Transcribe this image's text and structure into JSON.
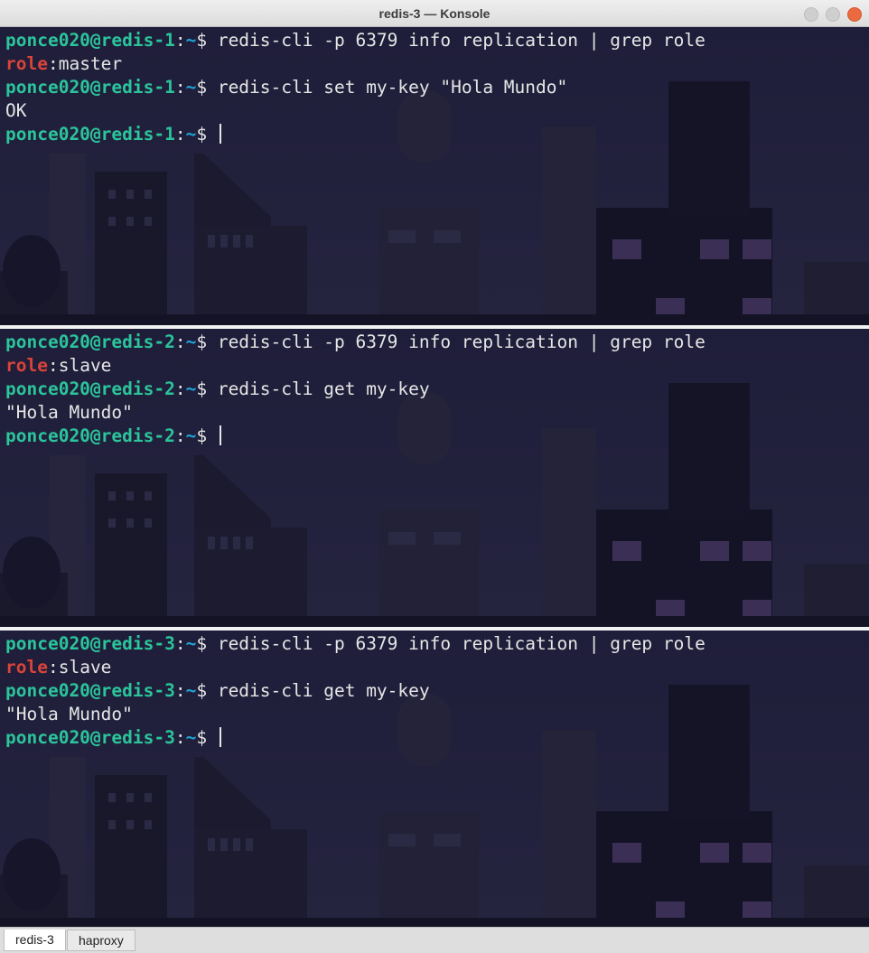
{
  "window": {
    "title": "redis-3 — Konsole"
  },
  "panes": [
    {
      "prompt_user": "ponce020@redis-1",
      "cwd": "~",
      "lines": [
        {
          "kind": "cmd",
          "command": "redis-cli -p 6379 info replication | grep role"
        },
        {
          "kind": "role",
          "key": "role",
          "value": "master"
        },
        {
          "kind": "cmd",
          "command": "redis-cli set my-key \"Hola Mundo\""
        },
        {
          "kind": "out",
          "text": "OK"
        },
        {
          "kind": "prompt"
        }
      ]
    },
    {
      "prompt_user": "ponce020@redis-2",
      "cwd": "~",
      "lines": [
        {
          "kind": "cmd",
          "command": "redis-cli -p 6379 info replication | grep role"
        },
        {
          "kind": "role",
          "key": "role",
          "value": "slave"
        },
        {
          "kind": "cmd",
          "command": "redis-cli get my-key"
        },
        {
          "kind": "out",
          "text": "\"Hola Mundo\""
        },
        {
          "kind": "prompt"
        }
      ]
    },
    {
      "prompt_user": "ponce020@redis-3",
      "cwd": "~",
      "lines": [
        {
          "kind": "cmd",
          "command": "redis-cli -p 6379 info replication | grep role"
        },
        {
          "kind": "role",
          "key": "role",
          "value": "slave"
        },
        {
          "kind": "cmd",
          "command": "redis-cli get my-key"
        },
        {
          "kind": "out",
          "text": "\"Hola Mundo\""
        },
        {
          "kind": "prompt"
        }
      ]
    }
  ],
  "tabs": [
    {
      "label": "redis-3",
      "active": true
    },
    {
      "label": "haproxy",
      "active": false
    }
  ],
  "colors": {
    "prompt_user": "#2bc49b",
    "prompt_path": "#1ea7d8",
    "role_key": "#d9433a",
    "terminal_bg": "#1d1c33",
    "close_button": "#ec6a3f"
  }
}
